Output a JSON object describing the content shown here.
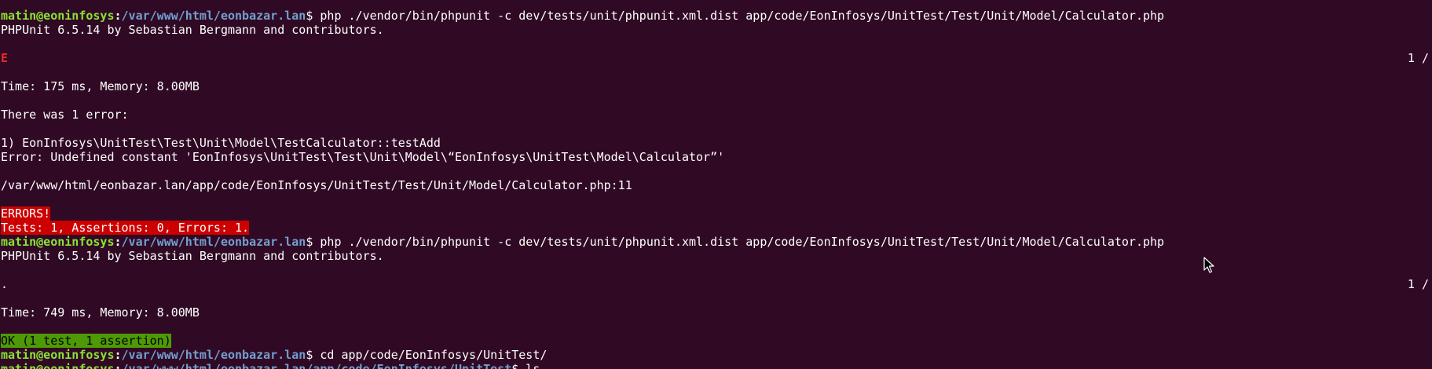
{
  "terminal": {
    "background": "#300a24",
    "prompt_colors": {
      "user": "#8ae234",
      "path": "#729fcf"
    },
    "run1": {
      "prompt_user": "matin@eoninfosys",
      "prompt_sep": ":",
      "prompt_path": "/var/www/html/eonbazar.lan",
      "prompt_dollar": "$ ",
      "command": "php ./vendor/bin/phpunit -c dev/tests/unit/phpunit.xml.dist app/code/EonInfosys/UnitTest/Test/Unit/Model/Calculator.php",
      "version_line": "PHPUnit 6.5.14 by Sebastian Bergmann and contributors.",
      "progress": "E",
      "progress_count": "1 /",
      "time_line": "Time: 175 ms, Memory: 8.00MB",
      "error_header": "There was 1 error:",
      "error_item": "1) EonInfosys\\UnitTest\\Test\\Unit\\Model\\TestCalculator::testAdd",
      "error_message": "Error: Undefined constant 'EonInfosys\\UnitTest\\Test\\Unit\\Model\\“EonInfosys\\UnitTest\\Model\\Calculator”'",
      "error_location": "/var/www/html/eonbazar.lan/app/code/EonInfosys/UnitTest/Test/Unit/Model/Calculator.php:11",
      "errors_badge": "ERRORS!",
      "summary_badge": "Tests: 1, Assertions: 0, Errors: 1."
    },
    "run2": {
      "prompt_user": "matin@eoninfosys",
      "prompt_sep": ":",
      "prompt_path": "/var/www/html/eonbazar.lan",
      "prompt_dollar": "$ ",
      "command": "php ./vendor/bin/phpunit -c dev/tests/unit/phpunit.xml.dist app/code/EonInfosys/UnitTest/Test/Unit/Model/Calculator.php",
      "version_line": "PHPUnit 6.5.14 by Sebastian Bergmann and contributors.",
      "progress": ".",
      "progress_count": "1 /",
      "time_line": "Time: 749 ms, Memory: 8.00MB",
      "ok_badge": "OK (1 test, 1 assertion)"
    },
    "run3": {
      "prompt_user": "matin@eoninfosys",
      "prompt_sep": ":",
      "prompt_path": "/var/www/html/eonbazar.lan",
      "prompt_dollar": "$ ",
      "command": "cd app/code/EonInfosys/UnitTest/"
    },
    "run4": {
      "prompt_user": "matin@eoninfosys",
      "prompt_sep": ":",
      "prompt_path": "/var/www/html/eonbazar.lan/app/code/EonInfosys/UnitTest",
      "prompt_dollar": "$ ",
      "command": "ls"
    }
  }
}
